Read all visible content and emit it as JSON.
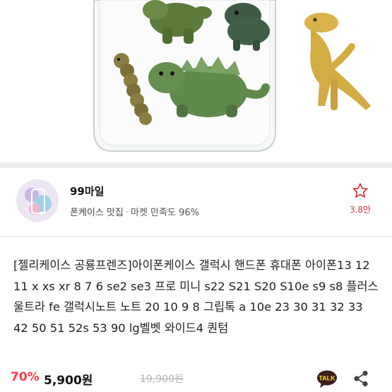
{
  "seller": {
    "name": "99마일",
    "category": "폰케이스 맛집",
    "separator": "·",
    "satisfaction": "마켓 만족도 96%",
    "favorite_count": "3.8만"
  },
  "product": {
    "title": "[젤리케이스 공룡프렌즈]아이폰케이스 갤럭시 핸드폰 휴대폰 아이폰13 12 11 x xs xr 8 7 6 se2 se3 프로 미니 s22 S21 S20 S10e s9 s8 플러스 울트라 fe 갤럭시노트 노트 20 10 9 8 그립톡 a 10e 23 30 31 32 33 42 50 51 52s 53 90 lg벨벳 와이드4 퀀텀",
    "discount": "70%",
    "price": "5,900원",
    "original_price": "19,900원"
  },
  "icons": {
    "favorite": "star-outline-icon",
    "talk": "kakaotalk-icon",
    "talk_label": "TALK",
    "share": "share-icon"
  },
  "colors": {
    "discount": "#ff3b4b",
    "favorite": "#d9333f",
    "talk_bg": "#3b1e1e",
    "talk_text": "#fee500"
  }
}
